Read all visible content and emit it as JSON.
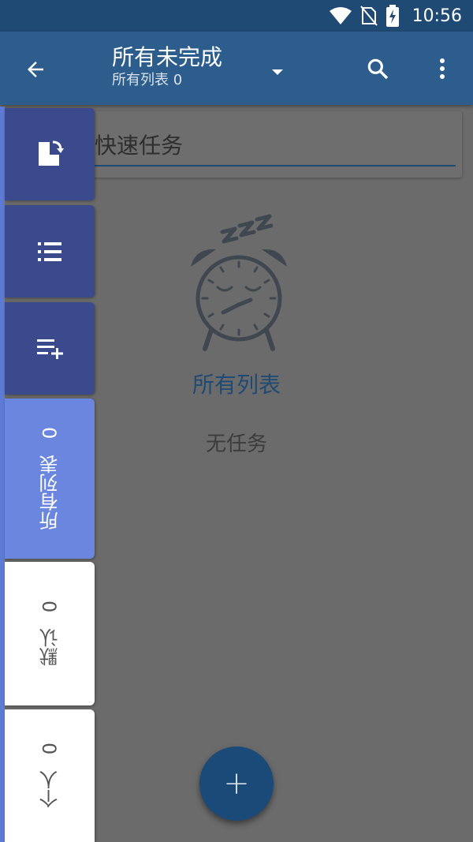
{
  "status_bar": {
    "time": "10:56"
  },
  "app_bar": {
    "title": "所有未完成",
    "subtitle": "所有列表 0"
  },
  "quick_task": {
    "placeholder": "快速任务"
  },
  "empty_state": {
    "list_name": "所有列表",
    "message": "无任务"
  },
  "fab": {
    "label": "+"
  },
  "side_lists": [
    {
      "name": "所有列表",
      "count": "0"
    },
    {
      "name": "默认",
      "count": "0"
    },
    {
      "name": "个人",
      "count": "0"
    }
  ],
  "colors": {
    "app_bar": "#2c5d8c",
    "status_bar": "#1f4a73",
    "accent": "#1f4a73",
    "active_tab": "#6a86df",
    "action_tab": "#3b4a8c"
  }
}
